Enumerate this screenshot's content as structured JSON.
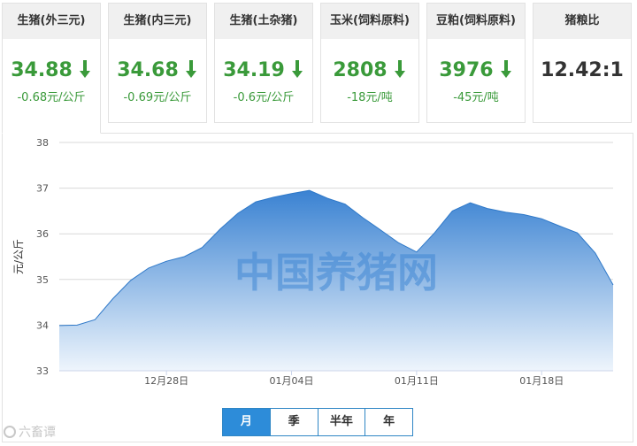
{
  "cards": [
    {
      "title": "生猪(外三元)",
      "price": "34.88",
      "change": "-0.68元/公斤",
      "direction": "down"
    },
    {
      "title": "生猪(内三元)",
      "price": "34.68",
      "change": "-0.69元/公斤",
      "direction": "down"
    },
    {
      "title": "生猪(土杂猪)",
      "price": "34.19",
      "change": "-0.6元/公斤",
      "direction": "down"
    },
    {
      "title": "玉米(饲料原料)",
      "price": "2808",
      "change": "-18元/吨",
      "direction": "down"
    },
    {
      "title": "豆粕(饲料原料)",
      "price": "3976",
      "change": "-45元/吨",
      "direction": "down"
    }
  ],
  "ratio_card": {
    "title": "猪粮比",
    "value": "12.42:1"
  },
  "colors": {
    "down": "#3a9a3a",
    "accent": "#2d8cd9",
    "area_top": "#3a82d2",
    "area_bottom": "#eef5fc"
  },
  "chart_data": {
    "type": "area",
    "ylabel": "元/公斤",
    "ylim": [
      33,
      38
    ],
    "yticks": [
      33,
      34,
      35,
      36,
      37,
      38
    ],
    "xlabels": [
      "12月28日",
      "01月04日",
      "01月11日",
      "01月18日"
    ],
    "xlabel_index": [
      6,
      13,
      20,
      27
    ],
    "watermark": "中国养猪网",
    "values": [
      33.99,
      34.0,
      34.12,
      34.58,
      34.98,
      35.25,
      35.4,
      35.5,
      35.7,
      36.1,
      36.45,
      36.7,
      36.8,
      36.88,
      36.95,
      36.78,
      36.65,
      36.35,
      36.08,
      35.8,
      35.6,
      36.02,
      36.5,
      36.68,
      36.55,
      36.47,
      36.42,
      36.33,
      36.17,
      36.02,
      35.58,
      34.88
    ],
    "grid": true
  },
  "tabs": [
    {
      "label": "月",
      "active": true
    },
    {
      "label": "季",
      "active": false
    },
    {
      "label": "半年",
      "active": false
    },
    {
      "label": "年",
      "active": false
    }
  ],
  "source_watermark": "六畜谭"
}
